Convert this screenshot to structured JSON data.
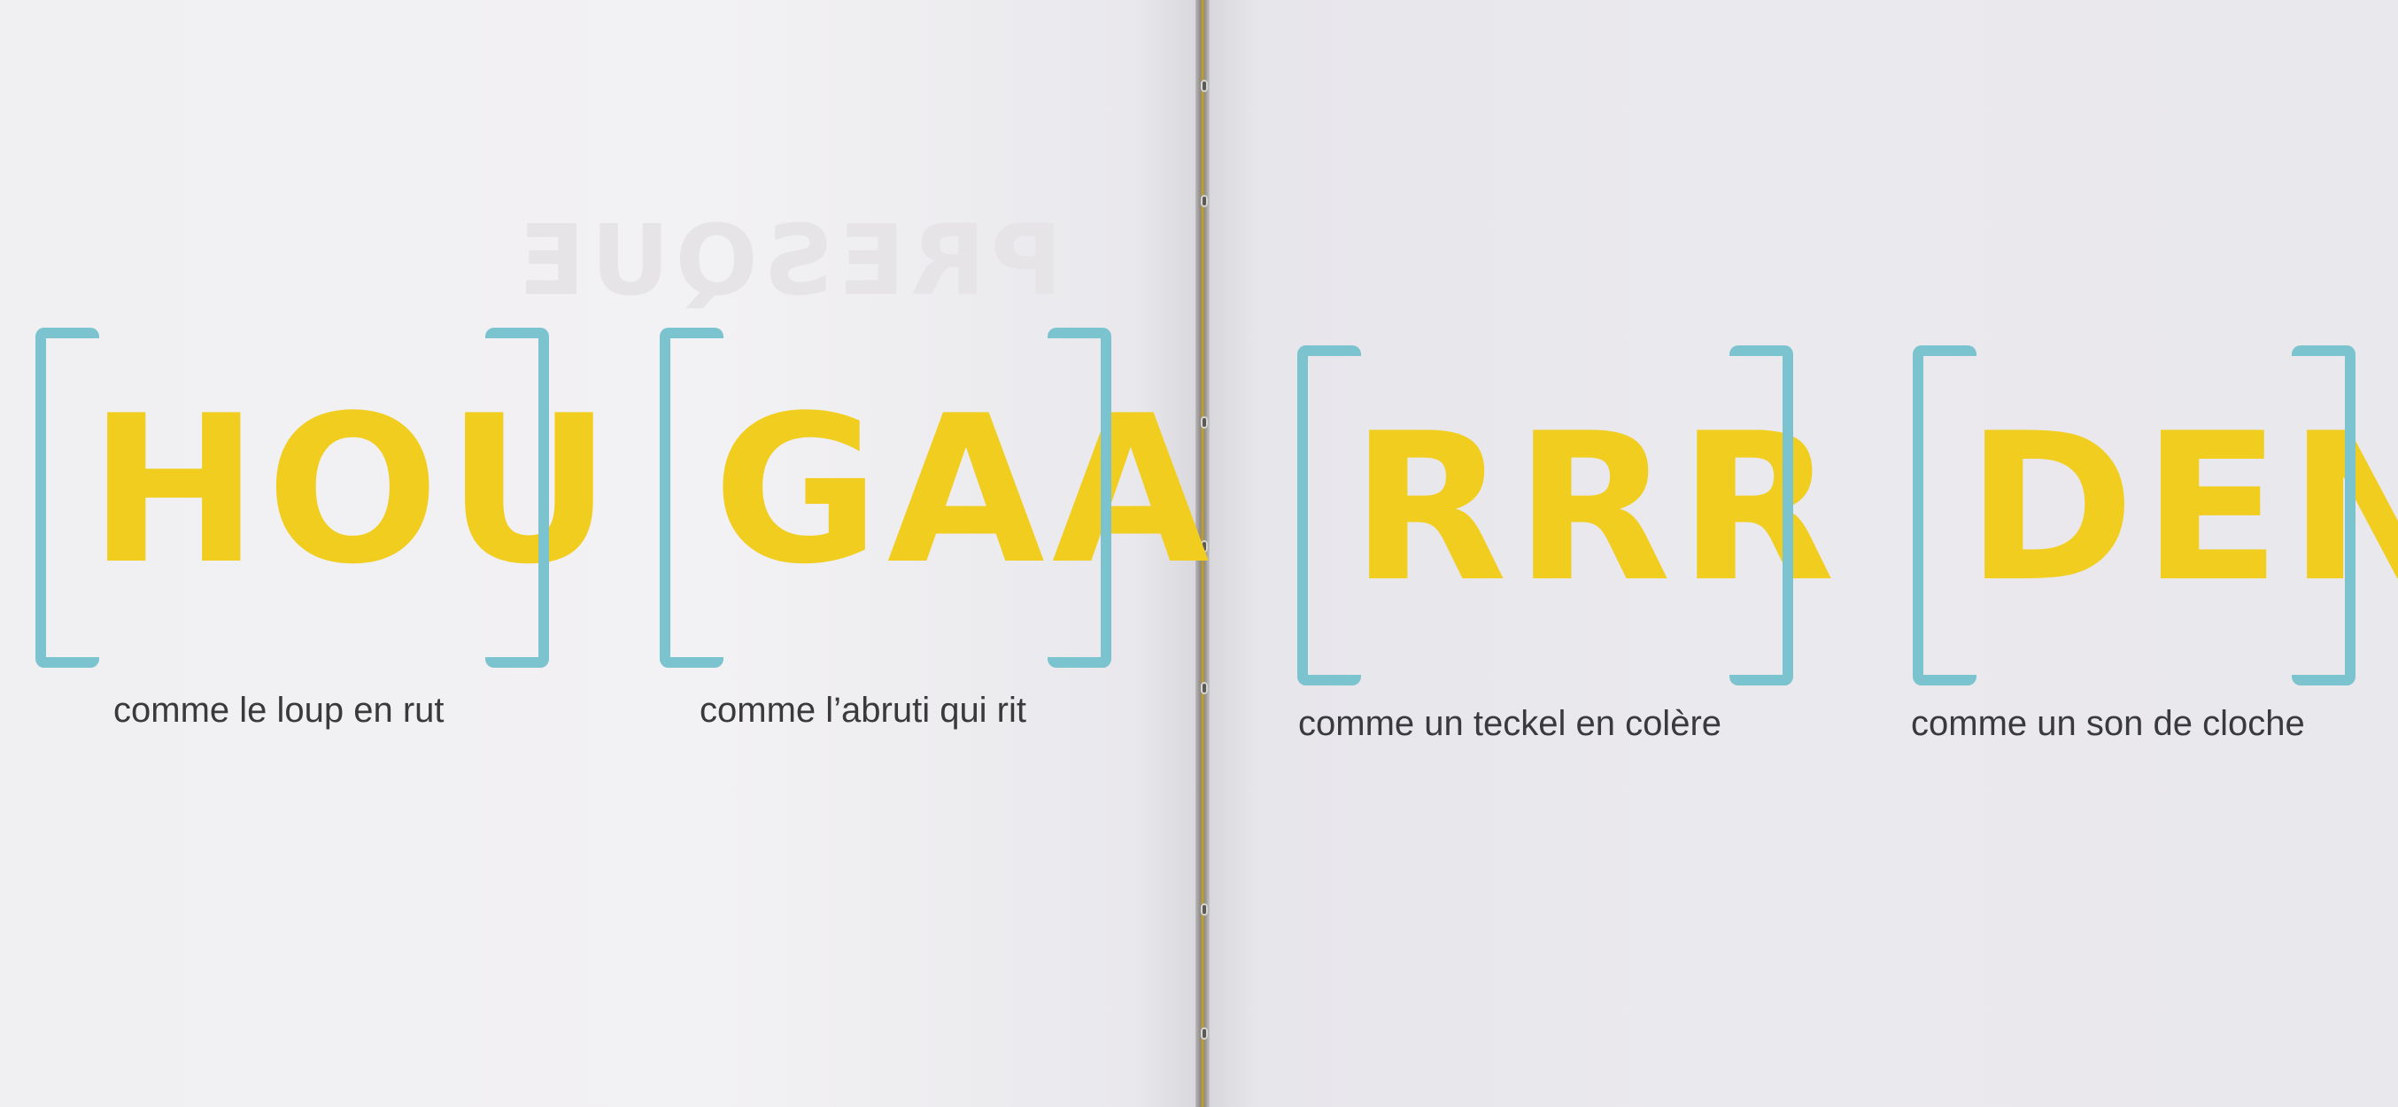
{
  "sounds": [
    {
      "word": "HOU",
      "caption": "comme le loup en rut"
    },
    {
      "word": "GAA",
      "caption": "comme l’abruti qui rit"
    },
    {
      "word": "RRR",
      "caption": "comme un teckel en colère"
    },
    {
      "word": "DEN",
      "caption": "comme un son de cloche"
    }
  ],
  "show_through_text": "PRESQUE",
  "colors": {
    "letters": "#f0cd1e",
    "brackets": "#7cc3d0",
    "captions": "#3a3a3c",
    "spine_thread": "#c9a11b"
  }
}
